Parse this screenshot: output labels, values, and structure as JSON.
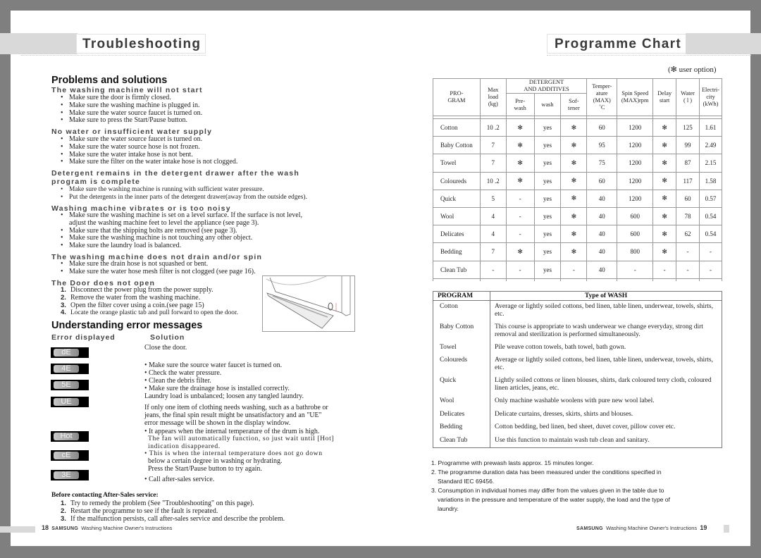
{
  "left_page": {
    "title": "Troubleshooting",
    "problems_heading": "Problems and solutions",
    "sections": [
      {
        "heading": "The washing machine will not start",
        "items": [
          "Make sure the door is firmly closed.",
          "Make sure the washing machine is plugged in.",
          "Make sure the water source faucet is turned on.",
          "Make sure to press the Start/Pause button."
        ]
      },
      {
        "heading": "No water or insufficient water supply",
        "items": [
          "Make sure the water source faucet is turned on.",
          "Make sure the water source hose is not frozen.",
          "Make sure the water intake hose is not bent.",
          "Make sure the filter on the water intake hose is not clogged."
        ]
      },
      {
        "heading_line1": "Detergent remains in the detergent drawer after the wash",
        "heading_line2": "program is complete",
        "items": [
          "Make sure the washing machine is running with sufficient water pressure.",
          "Put the detergents in the inner parts of the detergent drawer(away from the outside edges)."
        ]
      },
      {
        "heading": "Washing machine vibrates or is too noisy",
        "items": [
          "Make sure the washing machine is set on a level surface.  If the surface is not level, adjust the washing machine feet to level the appliance (see page 3).",
          "Make sure that the shipping bolts are removed (see page 3).",
          "Make sure the washing machine is not touching any other object.",
          "Make sure the laundry load is balanced."
        ]
      },
      {
        "heading": "The washing machine does not drain and/or spin",
        "items": [
          "Make sure the drain hose is not squashed or bent.",
          "Make sure the water hose mesh filter is not clogged (see page 16)."
        ]
      },
      {
        "heading": "The Door does not open",
        "steps": [
          {
            "num": "1.",
            "text": "Disconnect the power plug from the power supply."
          },
          {
            "num": "2.",
            "text": "Remove the water from the washing machine."
          },
          {
            "num": "3.",
            "text": "Open the filter cover using a coin.(see page 15)"
          },
          {
            "num": "4.",
            "text": "Locate the orange plastic tab and pull forward to open the door."
          }
        ]
      }
    ],
    "errors_heading": "Understanding error messages",
    "col_error": "Error displayed",
    "col_solution": "Solution",
    "errors": [
      {
        "code": "dE",
        "solution": "Close the door."
      },
      {
        "code": "4E",
        "solution": [
          "• Make sure the source water faucet is turned on.",
          "• Check the water pressure.",
          "• Clean the debris filter."
        ]
      },
      {
        "code": "5E",
        "solution": "• Make sure the drainage hose is installed correctly."
      },
      {
        "code": "UE",
        "solution": "Laundry load is unbalanced; loosen any tangled laundry.",
        "extra": "If only one item of clothing needs washing, such as a bathrobe or jeans, the final spin result might be unsatisfactory and an \"UE\" error message will be shown in the display window."
      },
      {
        "code": "Hot",
        "solution": "• It appears when the internal temperature of the drum is high.",
        "extra": "The fan will automatically function, so just wait until [Hot] indication disappeared."
      },
      {
        "code": "cE",
        "solution": "• This is when the internal temperature does not go down",
        "extra": "below a certain degree in washing or hydrating.",
        "extra2": "Press the Start/Pause button to try again."
      },
      {
        "code": "3E",
        "solution": "• Call after-sales service."
      }
    ],
    "before_contact": {
      "heading": "Before contacting After-Sales service:",
      "steps": [
        {
          "num": "1.",
          "text": "Try to remedy the problem (See \"Troubleshooting\" on this page)."
        },
        {
          "num": "2.",
          "text": "Restart the programme to see if the fault is repeated."
        },
        {
          "num": "3.",
          "text": " If the malfunction persists, call after-sales service and describe the problem."
        }
      ]
    },
    "footer": {
      "page": "18",
      "brand": "SAMSUNG",
      "text": "Washing Machine Owner's Instructions"
    }
  },
  "right_page": {
    "title": "Programme Chart",
    "user_option": "(✻ user option)",
    "table_headers": {
      "program": [
        "PRO-",
        "GRAM"
      ],
      "max_load": [
        "Max",
        "load",
        "(kg)"
      ],
      "detergent": [
        "DETERGENT",
        "AND ADDITIVES"
      ],
      "prewash": [
        "Pre-",
        "wash"
      ],
      "wash": "wash",
      "softener": [
        "Sof-",
        "tener"
      ],
      "temperature": [
        "Temper-",
        "ature",
        "(MAX)",
        "˚C"
      ],
      "spin": [
        "Spin Speed",
        "(MAX)rpm"
      ],
      "delay": [
        "Delay",
        "start"
      ],
      "water": [
        "Water",
        "( l )"
      ],
      "electricity": [
        "Electri-",
        "city",
        "(kWh)"
      ]
    },
    "programs": [
      {
        "name": "Cotton",
        "load": "10 .2",
        "prewash": "✻",
        "wash": "yes",
        "softener": "✻",
        "temp": "60",
        "spin": "1200",
        "delay": "✻",
        "water": "125",
        "elec": "1.61"
      },
      {
        "name": "Baby Cotton",
        "load": "7",
        "prewash": "✻",
        "wash": "yes",
        "softener": "✻",
        "temp": "95",
        "spin": "1200",
        "delay": "✻",
        "water": "99",
        "elec": "2.49"
      },
      {
        "name": "Towel",
        "load": "7",
        "prewash": "✻",
        "wash": "yes",
        "softener": "✻",
        "temp": "75",
        "spin": "1200",
        "delay": "✻",
        "water": "87",
        "elec": "2.15"
      },
      {
        "name": "Coloureds",
        "load": "10 .2",
        "prewash": "✻",
        "wash": "yes",
        "softener": "✻",
        "temp": "60",
        "spin": "1200",
        "delay": "✻",
        "water": "117",
        "elec": "1.58"
      },
      {
        "name": "Quick",
        "load": "5",
        "prewash": "-",
        "wash": "yes",
        "softener": "✻",
        "temp": "40",
        "spin": "1200",
        "delay": "✻",
        "water": "60",
        "elec": "0.57"
      },
      {
        "name": "Wool",
        "load": "4",
        "prewash": "-",
        "wash": "yes",
        "softener": "✻",
        "temp": "40",
        "spin": "600",
        "delay": "✻",
        "water": "78",
        "elec": "0.54"
      },
      {
        "name": "Delicates",
        "load": "4",
        "prewash": "-",
        "wash": "yes",
        "softener": "✻",
        "temp": "40",
        "spin": "600",
        "delay": "✻",
        "water": "62",
        "elec": "0.54"
      },
      {
        "name": "Bedding",
        "load": "7",
        "prewash": "✻",
        "wash": "yes",
        "softener": "✻",
        "temp": "40",
        "spin": "800",
        "delay": "✻",
        "water": "-",
        "elec": "-"
      },
      {
        "name": "Clean Tub",
        "load": "-",
        "prewash": "-",
        "wash": "yes",
        "softener": "-",
        "temp": "40",
        "spin": "-",
        "delay": "-",
        "water": "-",
        "elec": "-"
      }
    ],
    "wash_table": {
      "col_program": "PROGRAM",
      "col_type": "Type of  WASH",
      "rows": [
        {
          "program": "Cotton",
          "type": "Average or lightly soiled cottons, bed linen, table linen, underwear, towels, shirts, etc."
        },
        {
          "program": "Baby Cotton",
          "type": "This course is appropriate to wash underwear we change everyday, strong dirt removal and sterilization is performed simultaneously."
        },
        {
          "program": "Towel",
          "type": "Pile weave cotton towels, bath towel, bath gown."
        },
        {
          "program": "Coloureds",
          "type": "Average or lightly soiled cottons, bed linen, table linen, underwear, towels, shirts, etc."
        },
        {
          "program": "Quick",
          "type": "Lightly soiled cottons or linen blouses, shirts, dark coloured terry cloth, coloured linen articles, jeans, etc."
        },
        {
          "program": "Wool",
          "type": "Only machine washable woolens with pure new wool label."
        },
        {
          "program": "Delicates",
          "type": "Delicate curtains, dresses, skirts, shirts and blouses."
        },
        {
          "program": "Bedding",
          "type": "Cotton bedding, bed linen, bed sheet, duvet cover, pillow cover etc."
        },
        {
          "program": "Clean Tub",
          "type": "Use this function to maintain wash tub clean and sanitary."
        }
      ]
    },
    "notes": [
      "1. Programme with prewash lasts approx. 15 minutes longer.",
      "2. The programme duration data has been measured under the conditions specified in Standard IEC 69456.",
      "3. Consumption in individual homes may differ from the values given in the table due to variations in the pressure and temperature of the water supply, the load and the type of laundry."
    ],
    "footer": {
      "brand": "SAMSUNG",
      "text": "Washing Machine Owner's Instructions",
      "page": "19"
    }
  }
}
